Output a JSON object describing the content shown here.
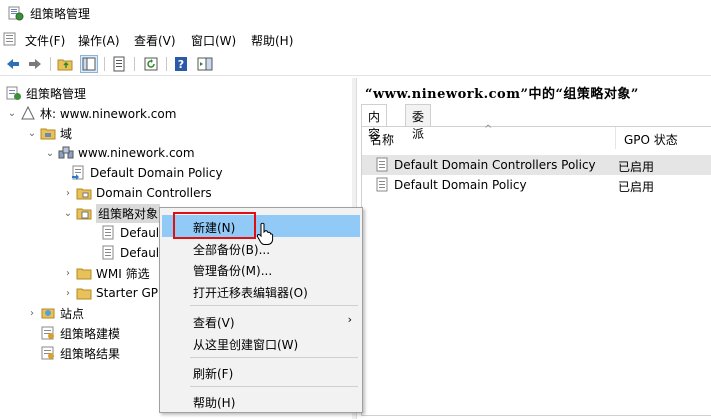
{
  "window": {
    "title": "组策略管理"
  },
  "menubar": {
    "items": [
      "文件(F)",
      "操作(A)",
      "查看(V)",
      "窗口(W)",
      "帮助(H)"
    ]
  },
  "toolbar": {
    "icons": [
      "back-arrow-icon",
      "forward-arrow-icon",
      "folder-up-icon",
      "show-hide-tree-icon",
      "properties-icon",
      "refresh-icon",
      "help-icon",
      "action-pane-icon"
    ]
  },
  "tree": {
    "root": "组策略管理",
    "forest": "林: www.ninework.com",
    "domains": "域",
    "domain": "www.ninework.com",
    "default_domain_policy": "Default Domain Policy",
    "domain_controllers": "Domain Controllers",
    "gpo_container": "组策略对象",
    "gpo_child1": "Defaul",
    "gpo_child2": "Defaul",
    "wmi_filters": "WMI 筛选",
    "starter_gpos": "Starter GP",
    "sites": "站点",
    "modeling": "组策略建模",
    "results": "组策略结果"
  },
  "right_pane": {
    "title": "“www.ninework.com”中的“组策略对象”",
    "tabs": [
      "内容",
      "委派"
    ],
    "columns": {
      "name": "名称",
      "status": "GPO 状态"
    },
    "rows": [
      {
        "name": "Default Domain Controllers Policy",
        "status": "已启用"
      },
      {
        "name": "Default Domain Policy",
        "status": "已启用"
      }
    ]
  },
  "context_menu": {
    "items": [
      {
        "label": "新建(N)"
      },
      {
        "label": "全部备份(B)..."
      },
      {
        "label": "管理备份(M)..."
      },
      {
        "label": "打开迁移表编辑器(O)"
      },
      {
        "label": "查看(V)"
      },
      {
        "label": "从这里创建窗口(W)"
      },
      {
        "label": "刷新(F)"
      },
      {
        "label": "帮助(H)"
      }
    ]
  },
  "colors": {
    "hover": "#91c9f7",
    "highlight_border": "#e01010",
    "selected_row": "#e5e5e5"
  }
}
